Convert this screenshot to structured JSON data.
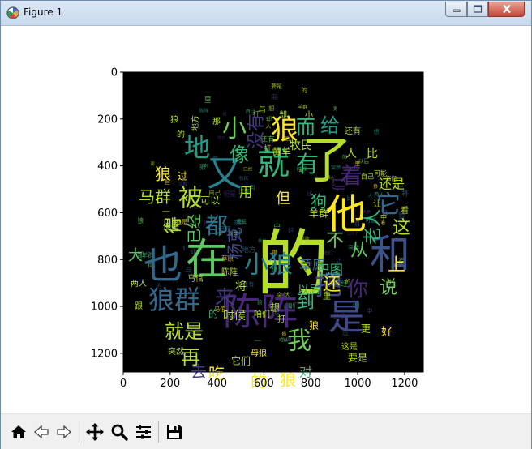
{
  "window": {
    "title": "Figure 1",
    "icon": "matplotlib-icon"
  },
  "toolbar": {
    "buttons": [
      "home-icon",
      "back-icon",
      "forward-icon",
      "pan-icon",
      "zoom-icon",
      "configure-subplots-icon",
      "save-icon"
    ]
  },
  "chart_data": {
    "type": "heatmap",
    "description_kind": "word cloud image rendered with imshow",
    "xlim": [
      0,
      1280
    ],
    "ylim": [
      1280,
      0
    ],
    "xticks": [
      "0",
      "200",
      "400",
      "600",
      "800",
      "1000",
      "1200"
    ],
    "yticks": [
      "0",
      "200",
      "400",
      "600",
      "800",
      "1000",
      "1200"
    ],
    "words": [
      {
        "text": "的",
        "size": "xl",
        "color": "#b5de2b"
      },
      {
        "text": "了",
        "size": "l",
        "color": "#b5de2b"
      },
      {
        "text": "在",
        "size": "l",
        "color": "#5ec962"
      },
      {
        "text": "和",
        "size": "l",
        "color": "#3b528b"
      },
      {
        "text": "也",
        "size": "l",
        "color": "#31688e"
      },
      {
        "text": "他",
        "size": "l",
        "color": "#fde725"
      },
      {
        "text": "陈阵",
        "size": "l",
        "color": "#482878"
      },
      {
        "text": "是",
        "size": "l",
        "color": "#3e4989"
      },
      {
        "text": "又",
        "size": "l",
        "color": "#26828e"
      },
      {
        "text": "就",
        "size": "l",
        "color": "#35b779"
      },
      {
        "text": "狼",
        "size": "m",
        "color": "#fde725"
      },
      {
        "text": "小",
        "size": "m",
        "color": "#6ece58"
      },
      {
        "text": "地",
        "size": "m",
        "color": "#1f9e89"
      },
      {
        "text": "有",
        "size": "m",
        "color": "#35b779"
      },
      {
        "text": "着",
        "size": "m",
        "color": "#482878"
      },
      {
        "text": "它",
        "size": "m",
        "color": "#31688e"
      },
      {
        "text": "被",
        "size": "m",
        "color": "#b5de2b"
      },
      {
        "text": "狼群",
        "size": "m",
        "color": "#31688e"
      },
      {
        "text": "把",
        "size": "m",
        "color": "#3e4989"
      },
      {
        "text": "小狼",
        "size": "m",
        "color": "#26828e"
      },
      {
        "text": "我",
        "size": "m",
        "color": "#6ece58"
      },
      {
        "text": "都",
        "size": "m",
        "color": "#2a788e"
      },
      {
        "text": "而",
        "size": "m",
        "color": "#35b779"
      },
      {
        "text": "给",
        "size": "m",
        "color": "#1f9e89"
      },
      {
        "text": "像",
        "size": "m",
        "color": "#35b779"
      },
      {
        "text": "没有",
        "size": "m",
        "color": "#443983"
      },
      {
        "text": "你",
        "size": "m",
        "color": "#482878"
      },
      {
        "text": "上",
        "size": "m",
        "color": "#fde725"
      },
      {
        "text": "说",
        "size": "m",
        "color": "#6ece58"
      },
      {
        "text": "这",
        "size": "m",
        "color": "#b5de2b"
      },
      {
        "text": "从",
        "size": "m",
        "color": "#5ec962"
      },
      {
        "text": "不",
        "size": "m",
        "color": "#6ece58"
      },
      {
        "text": "老人",
        "size": "m",
        "color": "#35b779"
      },
      {
        "text": "来",
        "size": "m",
        "color": "#443983"
      },
      {
        "text": "到",
        "size": "m",
        "color": "#35b779"
      },
      {
        "text": "还",
        "size": "m",
        "color": "#fde725"
      },
      {
        "text": "就是",
        "size": "m",
        "color": "#b5de2b"
      },
      {
        "text": "再",
        "size": "m",
        "color": "#b5de2b"
      },
      {
        "text": "去",
        "size": "m",
        "color": "#443983"
      },
      {
        "text": "吃",
        "size": "m",
        "color": "#fde725"
      },
      {
        "text": "的",
        "size": "s",
        "color": "#fde725"
      },
      {
        "text": "狼",
        "size": "s",
        "color": "#fde725"
      },
      {
        "text": "对",
        "size": "s",
        "color": "#35b779"
      },
      {
        "text": "但",
        "size": "s",
        "color": "#fde725"
      },
      {
        "text": "用",
        "size": "s",
        "color": "#b5de2b"
      },
      {
        "text": "狗",
        "size": "s",
        "color": "#35b779"
      },
      {
        "text": "马群",
        "size": "s",
        "color": "#b5de2b"
      },
      {
        "text": "得",
        "size": "s",
        "color": "#b5de2b"
      },
      {
        "text": "已经",
        "size": "s",
        "color": "#5ec962"
      },
      {
        "text": "杨克",
        "size": "s",
        "color": "#3e4989"
      },
      {
        "text": "大",
        "size": "s",
        "color": "#5ec962"
      },
      {
        "text": "草原",
        "size": "s",
        "color": "#31688e"
      },
      {
        "text": "巴图",
        "size": "s",
        "color": "#35b779"
      },
      {
        "text": "以后",
        "size": "s",
        "color": "#35b779"
      },
      {
        "text": "时候",
        "size": "s",
        "color": "#b5de2b"
      },
      {
        "text": "的",
        "size": "s",
        "color": "#35b779"
      },
      {
        "text": "狼",
        "size": "s",
        "color": "#fde725"
      },
      {
        "text": "牧民",
        "size": "s",
        "color": "#b5de2b"
      },
      {
        "text": "黄羊",
        "size": "s",
        "color": "#b5de2b"
      },
      {
        "text": "人",
        "size": "s",
        "color": "#b5de2b"
      },
      {
        "text": "比",
        "size": "s",
        "color": "#b5de2b"
      },
      {
        "text": "还是",
        "size": "s",
        "color": "#b5de2b"
      },
      {
        "text": "们",
        "size": "s",
        "color": "#482878"
      },
      {
        "text": "可以",
        "size": "s",
        "color": "#b5de2b"
      },
      {
        "text": "一",
        "size": "s",
        "color": "#b5de2b"
      },
      {
        "text": "将",
        "size": "s",
        "color": "#b5de2b"
      },
      {
        "text": "想",
        "size": "s",
        "color": "#b5de2b"
      },
      {
        "text": "它们",
        "size": "s",
        "color": "#b5de2b"
      },
      {
        "text": "咱们",
        "size": "s",
        "color": "#b5de2b"
      },
      {
        "text": "打",
        "size": "s",
        "color": "#b5de2b"
      },
      {
        "text": "狼",
        "size": "s",
        "color": "#fde725"
      },
      {
        "text": "过",
        "size": "s",
        "color": "#fde725"
      },
      {
        "text": "羊群",
        "size": "s",
        "color": "#b5de2b"
      },
      {
        "text": "但是",
        "size": "s",
        "color": "#b5de2b"
      },
      {
        "text": "两人",
        "size": "s",
        "color": "#b5de2b"
      },
      {
        "text": "马倌",
        "size": "s",
        "color": "#b5de2b"
      },
      {
        "text": "陈阵",
        "size": "s",
        "color": "#b5de2b"
      },
      {
        "text": "却",
        "size": "s",
        "color": "#b5de2b"
      },
      {
        "text": "好",
        "size": "s",
        "color": "#fde725"
      },
      {
        "text": "更",
        "size": "s",
        "color": "#b5de2b"
      },
      {
        "text": "要是",
        "size": "s",
        "color": "#b5de2b"
      },
      {
        "text": "母狼",
        "size": "s",
        "color": "#fde725"
      },
      {
        "text": "突然",
        "size": "s",
        "color": "#b5de2b"
      },
      {
        "text": "跟",
        "size": "s",
        "color": "#b5de2b"
      },
      {
        "text": "这是",
        "size": "s",
        "color": "#b5de2b"
      },
      {
        "text": "的",
        "size": "s",
        "color": "#b5de2b"
      },
      {
        "text": "小",
        "size": "s",
        "color": "#b5de2b"
      },
      {
        "text": "还有",
        "size": "s",
        "color": "#b5de2b"
      },
      {
        "text": "自己",
        "size": "s",
        "color": "#b5de2b"
      },
      {
        "text": "地方",
        "size": "s",
        "color": "#b5de2b"
      },
      {
        "text": "可能",
        "size": "s",
        "color": "#b5de2b"
      },
      {
        "text": "看",
        "size": "s",
        "color": "#b5de2b"
      },
      {
        "text": "让",
        "size": "s",
        "color": "#b5de2b"
      },
      {
        "text": "里",
        "size": "s",
        "color": "#b5de2b"
      },
      {
        "text": "中",
        "size": "s",
        "color": "#b5de2b"
      },
      {
        "text": "狼",
        "size": "s",
        "color": "#b5de2b"
      },
      {
        "text": "那",
        "size": "s",
        "color": "#b5de2b"
      },
      {
        "text": "与",
        "size": "s",
        "color": "#b5de2b"
      }
    ]
  }
}
